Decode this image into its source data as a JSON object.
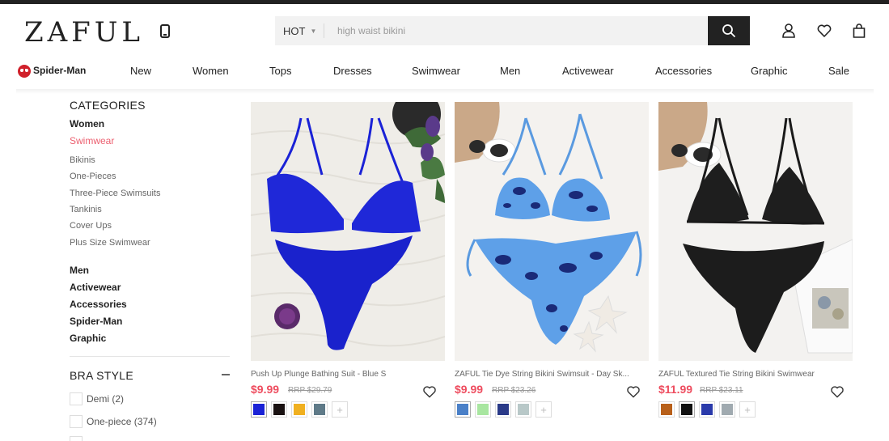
{
  "header": {
    "logo": "ZAFUL",
    "search": {
      "category": "HOT",
      "placeholder": "high waist bikini"
    },
    "icons": [
      "phone-icon",
      "search-icon",
      "user-icon",
      "heart-icon",
      "bag-icon"
    ]
  },
  "nav": {
    "items": [
      "Spider-Man",
      "New",
      "Women",
      "Tops",
      "Dresses",
      "Swimwear",
      "Men",
      "Activewear",
      "Accessories",
      "Graphic",
      "Sale"
    ]
  },
  "sidebar": {
    "categories_title": "CATEGORIES",
    "women": "Women",
    "swimwear": "Swimwear",
    "subcategories": [
      "Bikinis",
      "One-Pieces",
      "Three-Piece Swimsuits",
      "Tankinis",
      "Cover Ups",
      "Plus Size Swimwear"
    ],
    "main_categories": [
      "Men",
      "Activewear",
      "Accessories",
      "Spider-Man",
      "Graphic"
    ],
    "bra_style_title": "BRA STYLE",
    "bra_options": [
      "Demi (2)",
      "One-piece (374)"
    ],
    "accent_color": "#ec5f6f"
  },
  "products": [
    {
      "title": "Push Up Plunge Bathing Suit - Blue S",
      "price": "$9.99",
      "rrp": "RRP $29.79",
      "swatches": [
        "#1a22d6",
        "#1a1212",
        "#f0b020",
        "#5f7a88"
      ]
    },
    {
      "title": "ZAFUL Tie Dye String Bikini Swimsuit - Day Sk...",
      "price": "$9.99",
      "rrp": "RRP $23.26",
      "swatches": [
        "#4a80c8",
        "#a8e6a0",
        "#2a3a88",
        "#b8c8c8"
      ]
    },
    {
      "title": "ZAFUL Textured Tie String Bikini Swimwear",
      "price": "$11.99",
      "rrp": "RRP $23.11",
      "swatches": [
        "#b8601a",
        "#111111",
        "#2a3aaa",
        "#a0aab0"
      ]
    }
  ]
}
